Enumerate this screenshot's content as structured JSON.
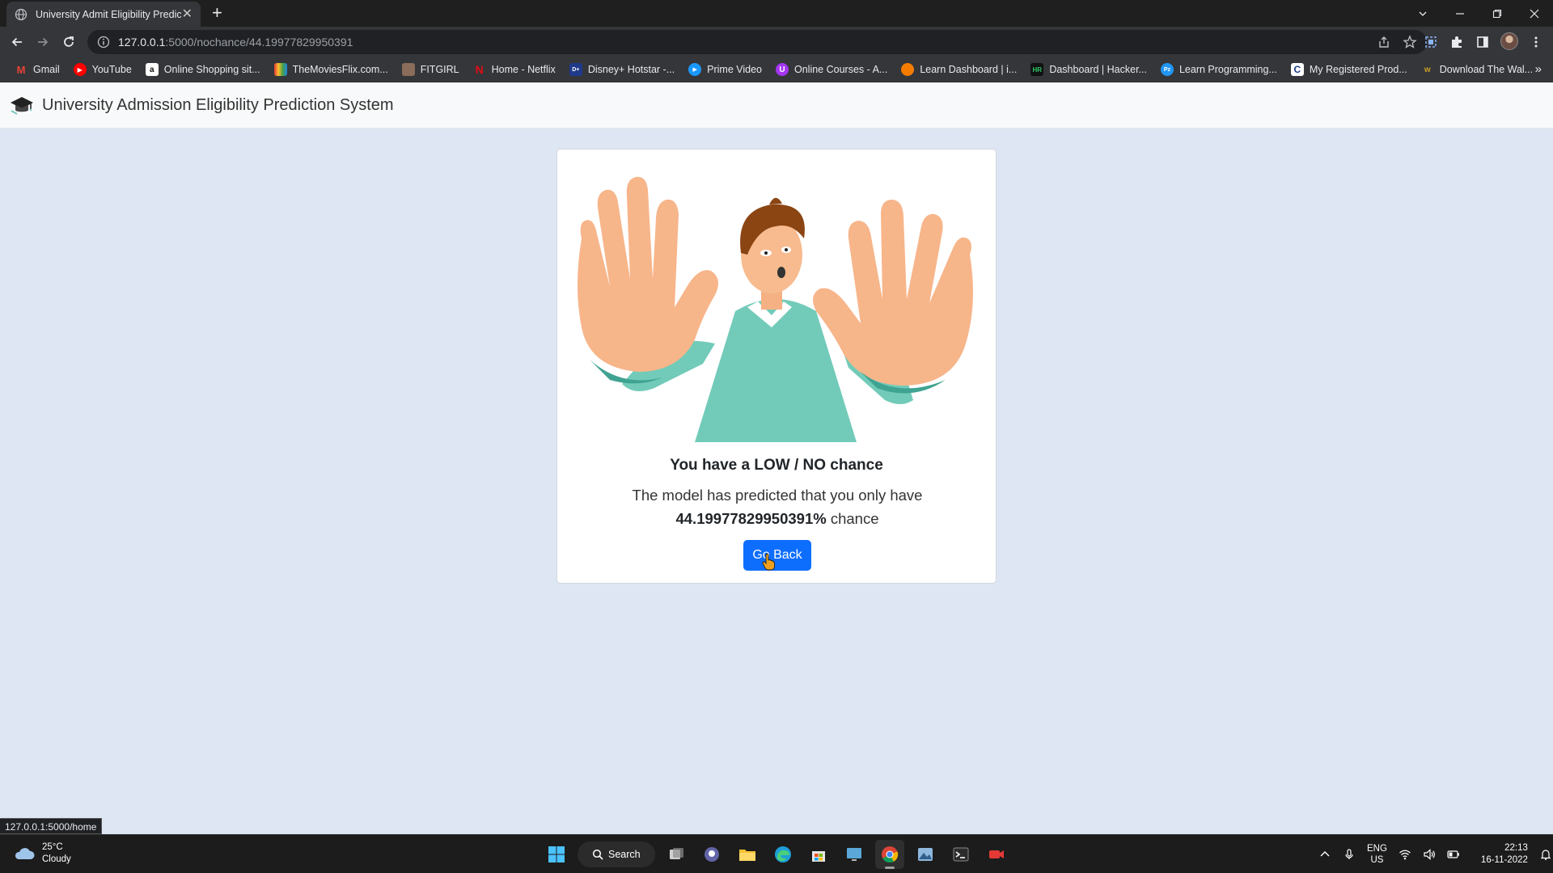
{
  "browser": {
    "tab_title": "University Admit Eligibility Predic",
    "url_host": "127.0.0.1",
    "url_path": ":5000/nochance/44.19977829950391",
    "bookmarks": [
      {
        "label": "Gmail",
        "icon": "gmail-icon",
        "color": "#ea4335"
      },
      {
        "label": "YouTube",
        "icon": "youtube-icon",
        "color": "#ff0000"
      },
      {
        "label": "Online Shopping sit...",
        "icon": "amazon-icon",
        "color": "#ffffff"
      },
      {
        "label": "TheMoviesFlix.com...",
        "icon": "moviesflix-icon",
        "color": "#4a6fd1"
      },
      {
        "label": "FITGIRL",
        "icon": "fitgirl-icon",
        "color": "#8a6d5b"
      },
      {
        "label": "Home - Netflix",
        "icon": "netflix-icon",
        "color": "#e50914"
      },
      {
        "label": "Disney+ Hotstar -...",
        "icon": "hotstar-icon",
        "color": "#1f3a8a"
      },
      {
        "label": "Prime Video",
        "icon": "prime-video-icon",
        "color": "#1a98ff"
      },
      {
        "label": "Online Courses - A...",
        "icon": "udemy-icon",
        "color": "#a435f0"
      },
      {
        "label": "Learn Dashboard | i...",
        "icon": "learn-dashboard-icon",
        "color": "#f57c00"
      },
      {
        "label": "Dashboard | Hacker...",
        "icon": "hackerrank-icon",
        "color": "#111111"
      },
      {
        "label": "Learn Programming...",
        "icon": "programiz-icon",
        "color": "#2196f3"
      },
      {
        "label": "My Registered Prod...",
        "icon": "registered-products-icon",
        "color": "#1e3a8a"
      },
      {
        "label": "Download The Wal...",
        "icon": "download-icon",
        "color": "#c9a227"
      }
    ]
  },
  "page": {
    "brand": "University Admission Eligibility Prediction System",
    "result_title": "You have a LOW / NO chance",
    "result_text": "The model has predicted that you only have",
    "percentage": "44.19977829950391%",
    "chance_word": "chance",
    "go_back_label": "Go Back",
    "status_url": "127.0.0.1:5000/home"
  },
  "taskbar": {
    "temperature": "25°C",
    "condition": "Cloudy",
    "search_label": "Search",
    "lang_top": "ENG",
    "lang_bottom": "US",
    "time": "22:13",
    "date": "16-11-2022"
  },
  "colors": {
    "primary_button": "#0d6efd",
    "page_background": "#dde6f2",
    "navbar": "#f8f9fa"
  }
}
